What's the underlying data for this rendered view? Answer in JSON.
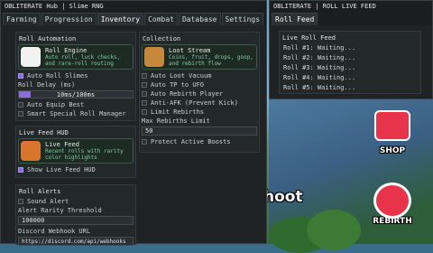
{
  "main": {
    "title": "OBLITERATE Hub | Slime RNG",
    "tabs": [
      "Farming",
      "Progression",
      "Inventory",
      "Combat",
      "Database",
      "Settings"
    ],
    "left": {
      "roll_automation": {
        "header": "Roll Automation",
        "engine_title": "Roll Engine",
        "engine_desc": "Auto roll, luck checks, and rare-roll routing",
        "auto_roll_slimes": "Auto Roll Slimes",
        "roll_delay_label": "Roll Delay (ms)",
        "roll_delay_value": "10ms/100ms",
        "roll_delay_fraction": 0.1,
        "auto_equip_best": "Auto Equip Best",
        "smart_special": "Smart Special Roll Manager"
      },
      "live_feed_hud": {
        "header": "Live Feed HUD",
        "title": "Live Feed",
        "desc": "Recent rolls with rarity color highlights",
        "show_hud": "Show Live Feed HUD"
      },
      "roll_alerts": {
        "header": "Roll Alerts",
        "sound_alert": "Sound Alert",
        "threshold_label": "Alert Rarity Threshold",
        "threshold_value": "100000",
        "webhook_label": "Discord Webhook URL",
        "webhook_value": "https://discord.com/api/webhooks"
      }
    },
    "right": {
      "collection": {
        "header": "Collection",
        "title": "Loot Stream",
        "desc": "Coins, fruit, drops, goop, and rebirth flow",
        "auto_loot_vacuum": "Auto Loot Vacuum",
        "auto_tp_ufo": "Auto TP to UFO",
        "auto_rebirth_player": "Auto Rebirth Player",
        "anti_afk": "Anti-AFK (Prevent Kick)",
        "limit_rebirths": "Limit Rebirths",
        "max_rebirths_label": "Max Rebirths Limit",
        "max_rebirths_value": "50",
        "protect_active_boosts": "Protect Active Boosts"
      }
    }
  },
  "feed": {
    "title": "OBLITERATE | ROLL LIVE FEED",
    "tab": "Roll Feed",
    "header": "Live Roll Feed",
    "lines": [
      "Roll #1: Waiting...",
      "Roll #2: Waiting...",
      "Roll #3: Waiting...",
      "Roll #4: Waiting...",
      "Roll #5: Waiting..."
    ]
  },
  "game": {
    "shoot_text": "hoot",
    "shop_label": "SHOP",
    "rebirth_label": "REBIRTH"
  }
}
